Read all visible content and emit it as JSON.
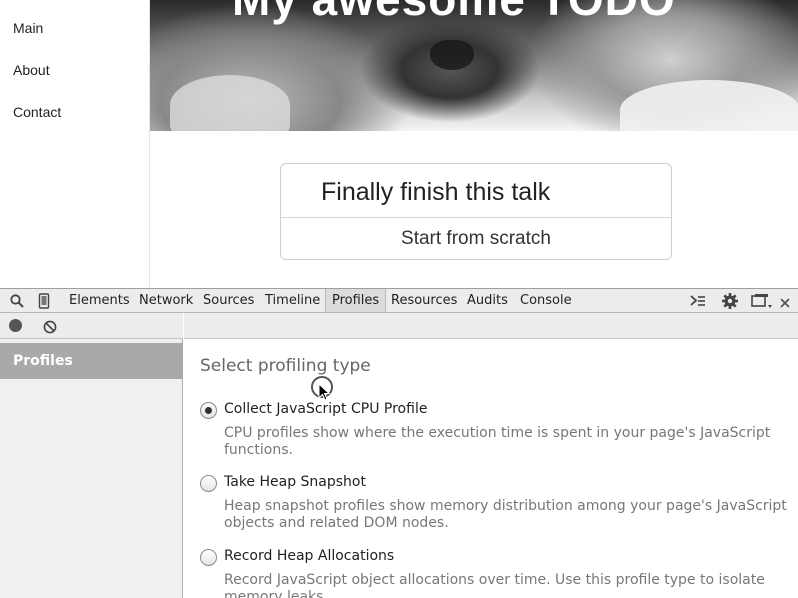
{
  "page": {
    "nav": [
      {
        "label": "Main"
      },
      {
        "label": "About"
      },
      {
        "label": "Contact"
      }
    ],
    "hero_title": "My awesome TODO",
    "todo": {
      "title": "Finally finish this talk",
      "items": [
        "Start from scratch"
      ]
    }
  },
  "devtools": {
    "tabs": [
      {
        "label": "Elements",
        "selected": false
      },
      {
        "label": "Network",
        "selected": false
      },
      {
        "label": "Sources",
        "selected": false
      },
      {
        "label": "Timeline",
        "selected": false
      },
      {
        "label": "Profiles",
        "selected": true
      },
      {
        "label": "Resources",
        "selected": false
      },
      {
        "label": "Audits",
        "selected": false
      },
      {
        "label": "Console",
        "selected": false
      }
    ],
    "sidebar": {
      "selected_item": "Profiles"
    },
    "main": {
      "section_title": "Select profiling type",
      "options": [
        {
          "label": "Collect JavaScript CPU Profile",
          "description": "CPU profiles show where the execution time is spent in your page's JavaScript functions.",
          "checked": true
        },
        {
          "label": "Take Heap Snapshot",
          "description": "Heap snapshot profiles show memory distribution among your page's JavaScript objects and related DOM nodes.",
          "checked": false
        },
        {
          "label": "Record Heap Allocations",
          "description": "Record JavaScript object allocations over time. Use this profile type to isolate memory leaks.",
          "checked": false
        }
      ]
    },
    "icons": {
      "search": "search-icon",
      "device": "device-mode-icon",
      "console_drawer": "show-console-icon",
      "settings": "gear-icon",
      "dock": "dock-side-icon",
      "close": "close-icon",
      "record": "record-icon",
      "clear": "clear-icon"
    }
  }
}
